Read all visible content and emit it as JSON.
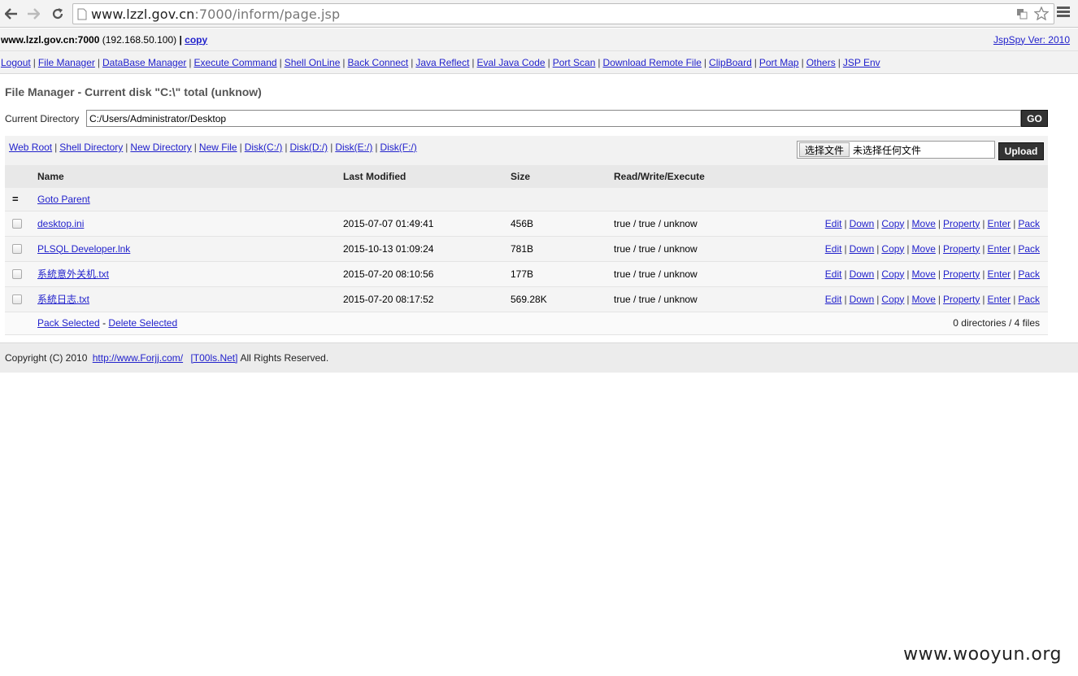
{
  "browser": {
    "url_host": "www.lzzl.gov.cn",
    "url_rest": ":7000/inform/page.jsp"
  },
  "header": {
    "host": "www.lzzl.gov.cn:7000",
    "ip": "(192.168.50.100)",
    "sep": "|",
    "copy_label": "copy",
    "version_label": "JspSpy Ver: 2010"
  },
  "nav": {
    "items": [
      "Logout",
      "File Manager",
      "DataBase Manager",
      "Execute Command",
      "Shell OnLine",
      "Back Connect",
      "Java Reflect",
      "Eval Java Code",
      "Port Scan",
      "Download Remote File",
      "ClipBoard",
      "Port Map",
      "Others",
      "JSP Env"
    ]
  },
  "main": {
    "title": "File Manager - Current disk \"C:\\\" total (unknow)",
    "current_dir_label": "Current Directory",
    "current_dir_value": "C:/Users/Administrator/Desktop",
    "go_label": "GO",
    "tool_links": [
      "Web Root",
      "Shell Directory",
      "New Directory",
      "New File",
      "Disk(C:/)",
      "Disk(D:/)",
      "Disk(E:/)",
      "Disk(F:/)"
    ],
    "choose_file_label": "选择文件",
    "no_file_label": "未选择任何文件",
    "upload_label": "Upload"
  },
  "table": {
    "headers": {
      "name": "Name",
      "modified": "Last Modified",
      "size": "Size",
      "rwx": "Read/Write/Execute"
    },
    "parent_icon": "=",
    "goto_parent": "Goto Parent",
    "rows": [
      {
        "name": "desktop.ini",
        "modified": "2015-07-07 01:49:41",
        "size": "456B",
        "rwx": "true / true / unknow"
      },
      {
        "name": "PLSQL Developer.lnk",
        "modified": "2015-10-13 01:09:24",
        "size": "781B",
        "rwx": "true / true / unknow"
      },
      {
        "name": "系統意外关机.txt",
        "modified": "2015-07-20 08:10:56",
        "size": "177B",
        "rwx": "true / true / unknow"
      },
      {
        "name": "系統日志.txt",
        "modified": "2015-07-20 08:17:52",
        "size": "569.28K",
        "rwx": "true / true / unknow"
      }
    ],
    "actions": [
      "Edit",
      "Down",
      "Copy",
      "Move",
      "Property",
      "Enter",
      "Pack"
    ],
    "pack_selected": "Pack Selected",
    "dash": "-",
    "delete_selected": "Delete Selected",
    "summary": "0 directories / 4 files"
  },
  "footer": {
    "copyright_prefix": "Copyright (C) 2010",
    "link1": "http://www.Forjj.com/",
    "link2": "[T00ls.Net]",
    "suffix": "All Rights Reserved."
  },
  "watermark": "www.wooyun.org"
}
